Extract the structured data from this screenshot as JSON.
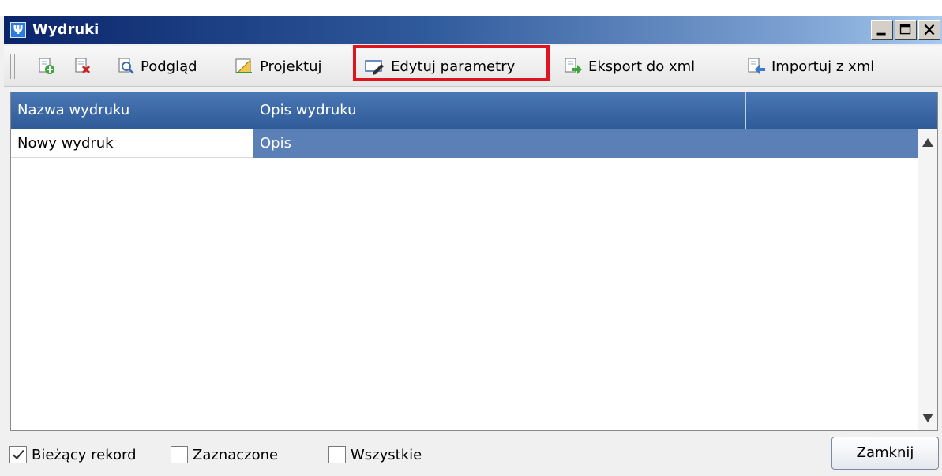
{
  "window": {
    "title": "Wydruki",
    "app_icon_glyph": "Ψ"
  },
  "toolbar": {
    "items": [
      {
        "label": "",
        "icon": "add-document-icon"
      },
      {
        "label": "",
        "icon": "delete-document-icon"
      },
      {
        "label": "Podgląd",
        "icon": "preview-icon"
      },
      {
        "label": "Projektuj",
        "icon": "design-icon"
      },
      {
        "label": "Edytuj parametry",
        "icon": "edit-parameters-icon"
      },
      {
        "label": "Eksport do xml",
        "icon": "export-xml-icon"
      },
      {
        "label": "Importuj z xml",
        "icon": "import-xml-icon"
      }
    ],
    "highlighted_item": "Edytuj parametry"
  },
  "grid": {
    "columns": [
      "Nazwa wydruku",
      "Opis wydruku",
      ""
    ],
    "rows": [
      {
        "name": "Nowy wydruk",
        "description": "Opis",
        "selected": true
      }
    ]
  },
  "footer": {
    "options": [
      {
        "label": "Bieżący rekord",
        "checked": true
      },
      {
        "label": "Zaznaczone",
        "checked": false
      },
      {
        "label": "Wszystkie",
        "checked": false
      }
    ],
    "close_label": "Zamknij"
  },
  "colors": {
    "header_bg": "#2f5b98",
    "selected_cell": "#5b7fb7",
    "highlight": "#e0141e"
  }
}
